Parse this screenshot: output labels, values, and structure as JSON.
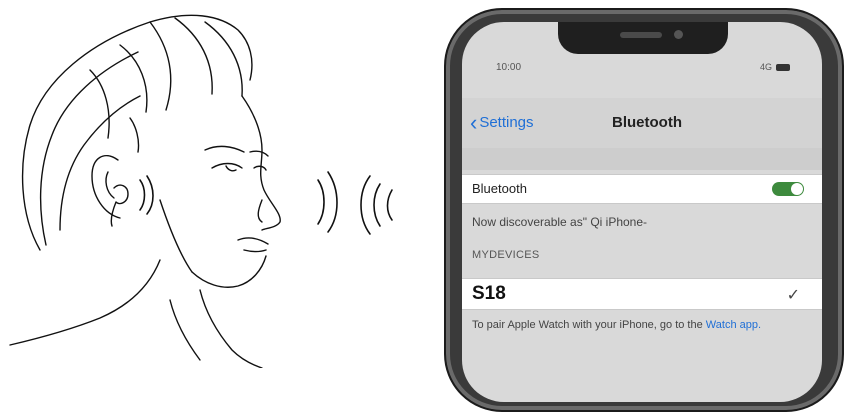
{
  "status": {
    "time": "10:00",
    "network": "4G"
  },
  "nav": {
    "back_label": "Settings",
    "title": "Bluetooth"
  },
  "bluetooth_row": {
    "label": "Bluetooth",
    "toggle_on": true
  },
  "discoverable_text": "Now discoverable as\" Qi iPhone-",
  "section_header": "MYDEVICES",
  "device": {
    "name": "S18",
    "connected": true
  },
  "footer": {
    "text": "To pair Apple Watch with your iPhone, go to the",
    "link": "Watch app."
  },
  "icons": [
    "back-chevron-icon",
    "checkmark-icon",
    "battery-icon",
    "sound-wave-icon"
  ],
  "colors": {
    "accent": "#1f6fd6",
    "toggle_on": "#3d8a3d"
  }
}
